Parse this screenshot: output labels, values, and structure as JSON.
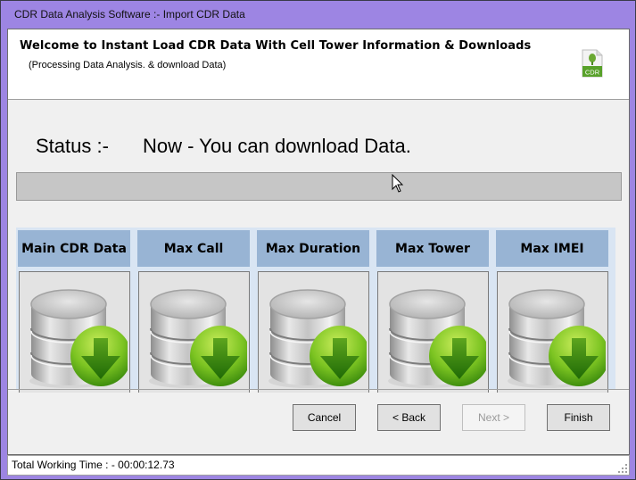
{
  "window": {
    "title": "CDR Data Analysis Software :- Import CDR Data"
  },
  "header": {
    "title": "Welcome to Instant Load CDR Data With Cell Tower Information & Downloads",
    "subtitle": "(Processing Data Analysis. & download Data)",
    "icon": "cdr-file-icon",
    "icon_label": "CDR"
  },
  "status": {
    "label": "Status :-",
    "value": "Now - You can download Data."
  },
  "progress": {
    "percent": 0
  },
  "downloads": [
    {
      "label": "Main CDR Data",
      "icon": "database-download-icon"
    },
    {
      "label": "Max Call",
      "icon": "database-download-icon"
    },
    {
      "label": "Max Duration",
      "icon": "database-download-icon"
    },
    {
      "label": "Max Tower",
      "icon": "database-download-icon"
    },
    {
      "label": "Max IMEI",
      "icon": "database-download-icon"
    }
  ],
  "buttons": {
    "cancel": "Cancel",
    "back": "< Back",
    "next": "Next >",
    "finish": "Finish"
  },
  "statusbar": {
    "text": "Total Working Time : - 00:00:12.73"
  },
  "colors": {
    "titlebar": "#9d85e3",
    "column_header": "#98b4d4",
    "column_bg": "#d9e5f3",
    "download_green": "#6cbf1a"
  }
}
